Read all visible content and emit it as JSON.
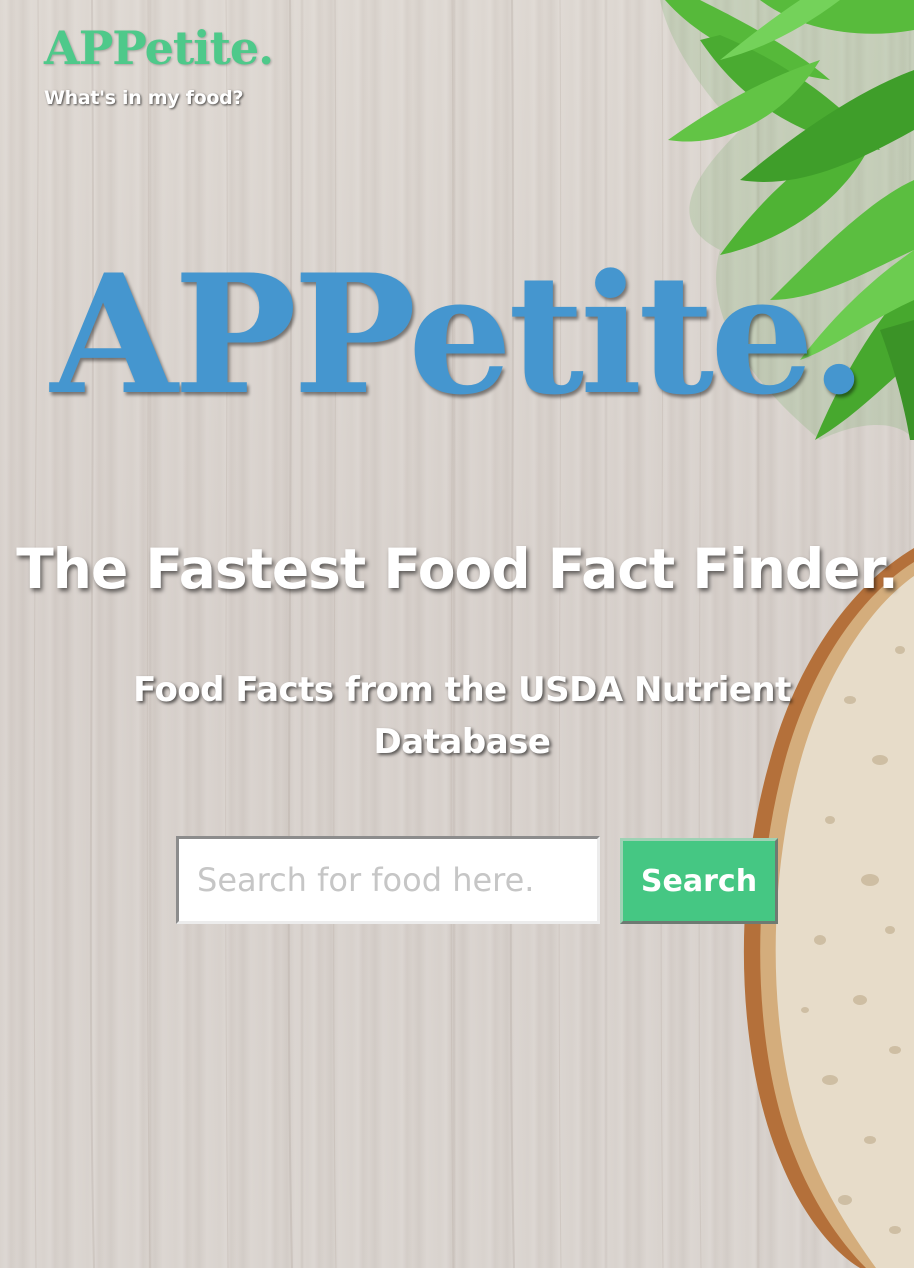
{
  "header": {
    "logo_text": "APPetite.",
    "tagline": "What's in my food?"
  },
  "hero": {
    "logo_text": "APPetite.",
    "headline": "The Fastest Food Fact Finder.",
    "subheadline": "Food Facts from the USDA Nutrient Database"
  },
  "search": {
    "placeholder": "Search for food here.",
    "value": "",
    "button_label": "Search"
  },
  "colors": {
    "brand_green": "#4ec98a",
    "hero_blue": "#4596cf",
    "button_green": "#45c783",
    "headline_text": "#ffffff"
  },
  "decor": {
    "top_right": "leafy-greens-image",
    "bottom_right": "bread-slice-image",
    "background": "wood-texture"
  }
}
